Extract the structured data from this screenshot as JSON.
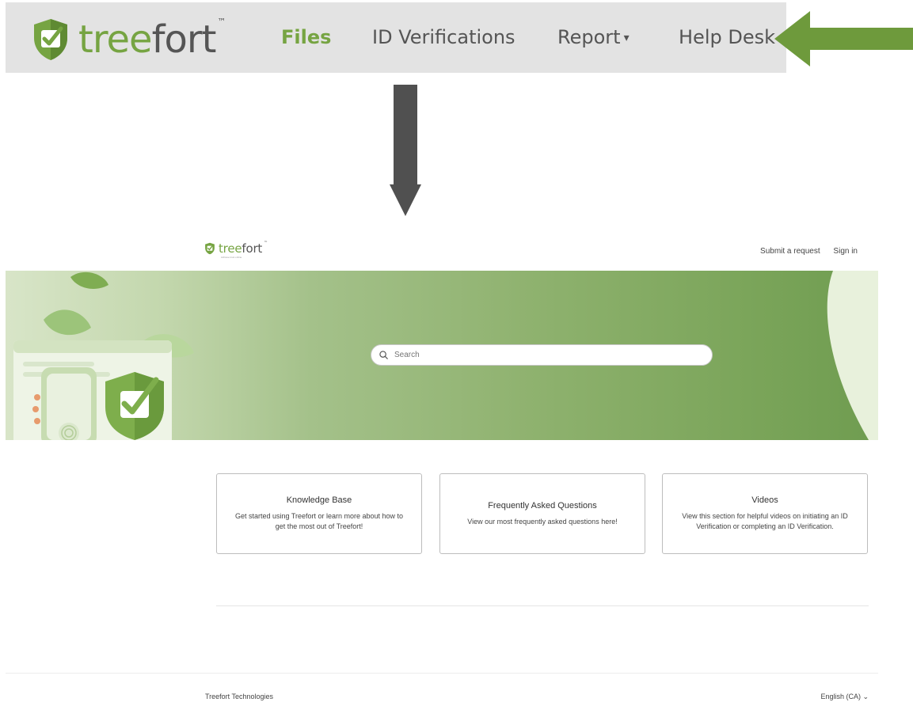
{
  "top_nav": {
    "logo_tree": "tree",
    "logo_fort": "fort",
    "logo_tm": "™",
    "items": [
      {
        "label": "Files"
      },
      {
        "label": "ID Verifications"
      },
      {
        "label": "Report"
      },
      {
        "label": "Help Desk"
      }
    ],
    "report_caret": "▾"
  },
  "help_center": {
    "logo_tree": "tree",
    "logo_fort": "fort",
    "logo_tm": "™",
    "tagline": "Achieve trust online.",
    "links": {
      "submit_request": "Submit a request",
      "sign_in": "Sign in"
    },
    "search": {
      "placeholder": "Search"
    },
    "cards": [
      {
        "title": "Knowledge Base",
        "description": "Get started using Treefort or learn more about how to get the most out of Treefort!"
      },
      {
        "title": "Frequently Asked Questions",
        "description": "View our most frequently asked questions here!"
      },
      {
        "title": "Videos",
        "description": "View this section for helpful videos on initiating an ID Verification or completing an ID Verification."
      }
    ],
    "footer": {
      "company": "Treefort Technologies",
      "language": "English (CA) ⌄"
    }
  },
  "colors": {
    "brand_green": "#76a442",
    "arrow_green": "#6e9a3c",
    "arrow_gray": "#505050",
    "nav_bg": "#e3e3e3"
  }
}
